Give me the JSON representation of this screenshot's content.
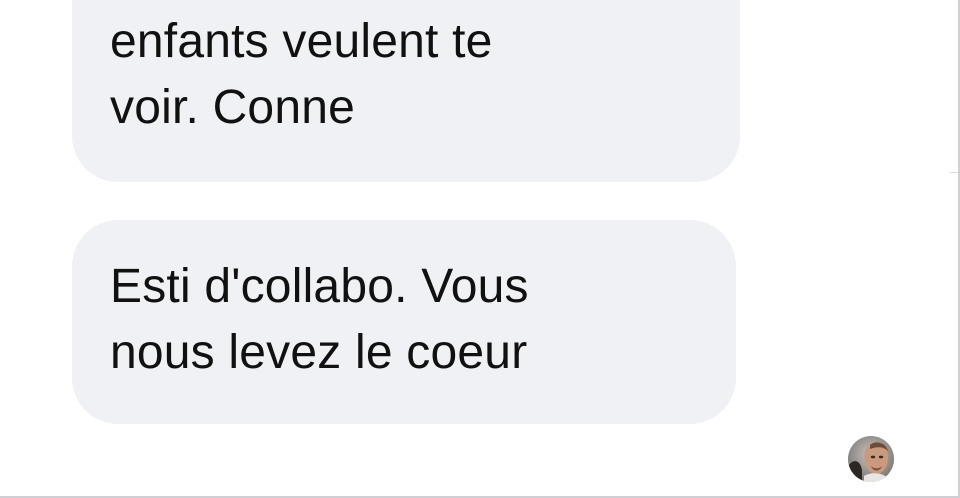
{
  "conversation": {
    "messages": [
      {
        "lines": [
          "enfants veulent te",
          "voir. Conne"
        ]
      },
      {
        "lines": [
          "Esti d'collabo. Vous",
          "nous levez le coeur"
        ]
      }
    ],
    "read_receipt": {
      "icon": "avatar-photo"
    }
  },
  "colors": {
    "bubble_background": "#f0f1f5",
    "text": "#111111",
    "page_background": "#ffffff"
  }
}
